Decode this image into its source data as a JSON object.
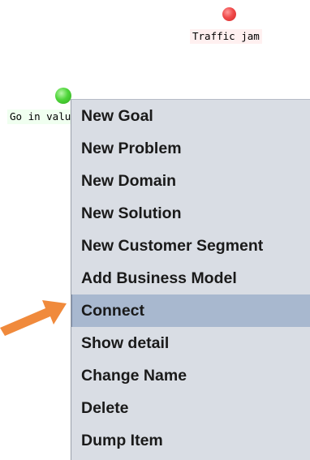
{
  "nodes": {
    "traffic_jam": {
      "label": "Traffic jam",
      "color": "#f04a4a"
    },
    "go_in_value": {
      "label": "Go in value",
      "color": "#4fd63a"
    }
  },
  "context_menu": {
    "items": [
      {
        "label": "New Goal"
      },
      {
        "label": "New Problem"
      },
      {
        "label": "New Domain"
      },
      {
        "label": "New Solution"
      },
      {
        "label": "New Customer Segment"
      },
      {
        "label": "Add Business Model"
      },
      {
        "label": "Connect",
        "highlighted": true
      },
      {
        "label": "Show detail"
      },
      {
        "label": "Change Name"
      },
      {
        "label": "Delete"
      },
      {
        "label": "Dump Item"
      }
    ]
  },
  "colors": {
    "menu_background": "#d9dde4",
    "menu_highlight": "#a8b8cf",
    "pointer_arrow": "#f08a3c"
  },
  "icons": {
    "pointer": "arrow-right-icon"
  }
}
